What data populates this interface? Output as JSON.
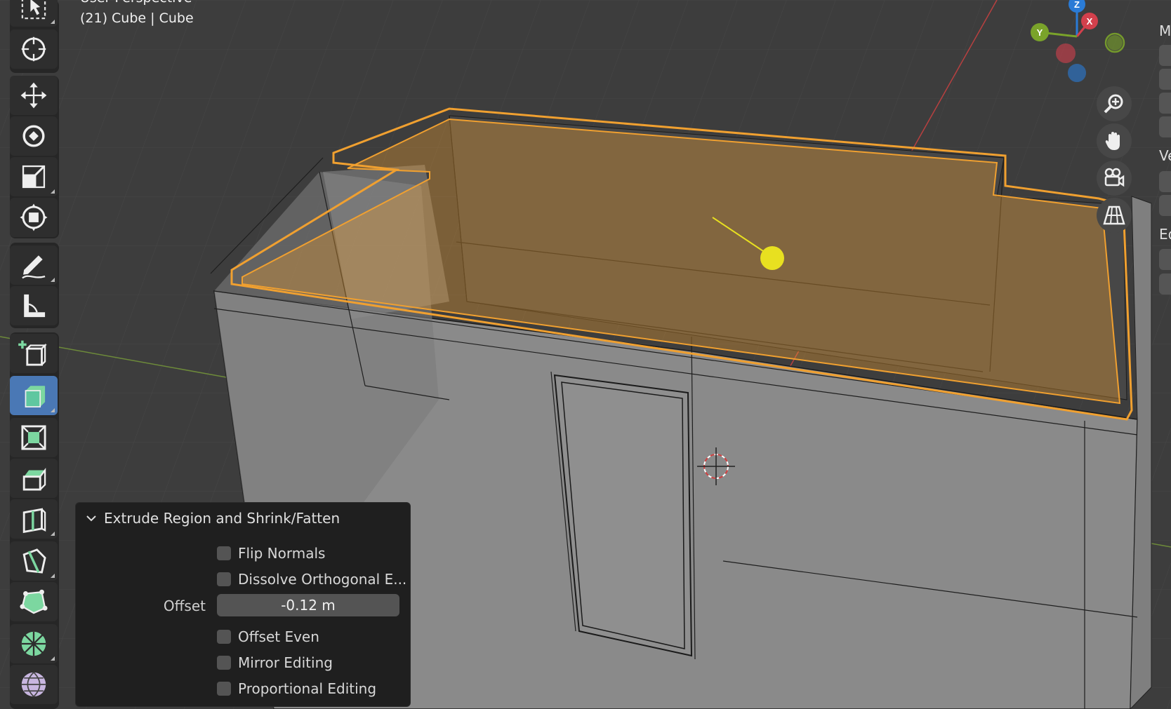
{
  "viewport": {
    "view_name_partial": "User Perspective",
    "object_info": "(21) Cube | Cube"
  },
  "gizmo": {
    "z_label": "Z",
    "x_label": "X",
    "y_label": "Y",
    "colors": {
      "x": "#d2404c",
      "y": "#7aa32a",
      "z": "#2a7bd6"
    }
  },
  "toolbar": {
    "tools": [
      {
        "name": "select-box-tool",
        "icon": "cursor-arrow-icon"
      },
      {
        "name": "cursor-tool",
        "icon": "crosshair-cursor-icon"
      },
      {
        "name": "move-tool",
        "icon": "move-arrows-icon"
      },
      {
        "name": "rotate-tool",
        "icon": "rotate-icon"
      },
      {
        "name": "scale-tool",
        "icon": "scale-icon"
      },
      {
        "name": "transform-tool",
        "icon": "transform-icon"
      },
      {
        "name": "annotate-tool",
        "icon": "pencil-icon"
      },
      {
        "name": "measure-tool",
        "icon": "ruler-icon"
      },
      {
        "name": "add-cube-tool",
        "icon": "add-cube-icon"
      },
      {
        "name": "extrude-region-tool",
        "icon": "extrude-icon",
        "active": true
      },
      {
        "name": "inset-faces-tool",
        "icon": "inset-icon"
      },
      {
        "name": "bevel-tool",
        "icon": "bevel-icon"
      },
      {
        "name": "loop-cut-tool",
        "icon": "loop-cut-icon"
      },
      {
        "name": "knife-tool",
        "icon": "knife-icon"
      },
      {
        "name": "poly-build-tool",
        "icon": "poly-build-icon"
      },
      {
        "name": "spin-tool",
        "icon": "spin-icon"
      },
      {
        "name": "smooth-tool",
        "icon": "smooth-sphere-icon"
      }
    ]
  },
  "nav": {
    "buttons": [
      {
        "name": "zoom-button",
        "icon": "zoom-icon"
      },
      {
        "name": "pan-button",
        "icon": "hand-icon"
      },
      {
        "name": "camera-button",
        "icon": "camera-icon"
      },
      {
        "name": "perspective-button",
        "icon": "grid-perspective-icon"
      }
    ]
  },
  "sidebar": {
    "letters": [
      "M",
      "Ve",
      "Ed"
    ]
  },
  "operator": {
    "title": "Extrude Region and Shrink/Fatten",
    "flip_normals": "Flip Normals",
    "dissolve": "Dissolve Orthogonal E...",
    "offset_label": "Offset",
    "offset_value": "-0.12 m",
    "offset_even": "Offset Even",
    "mirror_editing": "Mirror Editing",
    "proportional_editing": "Proportional Editing"
  },
  "colors": {
    "selection": "#f0a030",
    "active_tool": "#4a78b5",
    "light": "#e8e020"
  }
}
